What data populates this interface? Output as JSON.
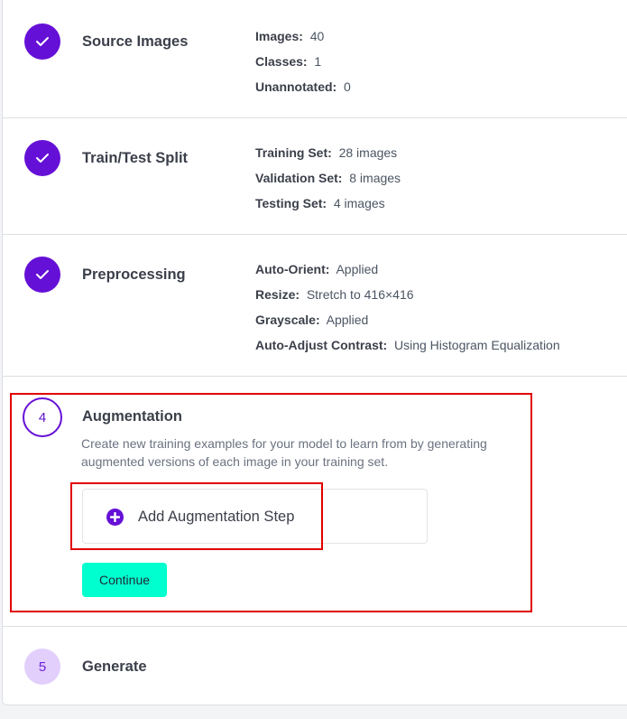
{
  "steps": [
    {
      "title": "Source Images",
      "details": [
        {
          "label": "Images:",
          "value": "40"
        },
        {
          "label": "Classes:",
          "value": "1"
        },
        {
          "label": "Unannotated:",
          "value": "0"
        }
      ]
    },
    {
      "title": "Train/Test Split",
      "details": [
        {
          "label": "Training Set:",
          "value": "28 images"
        },
        {
          "label": "Validation Set:",
          "value": "8 images"
        },
        {
          "label": "Testing Set:",
          "value": "4 images"
        }
      ]
    },
    {
      "title": "Preprocessing",
      "details": [
        {
          "label": "Auto-Orient:",
          "value": "Applied"
        },
        {
          "label": "Resize:",
          "value": "Stretch to 416×416"
        },
        {
          "label": "Grayscale:",
          "value": "Applied"
        },
        {
          "label": "Auto-Adjust Contrast:",
          "value": "Using Histogram Equalization"
        }
      ]
    }
  ],
  "augmentation": {
    "number": "4",
    "title": "Augmentation",
    "description": "Create new training examples for your model to learn from by generating augmented versions of each image in your training set.",
    "add_label": "Add Augmentation Step",
    "continue_label": "Continue"
  },
  "generate": {
    "number": "5",
    "title": "Generate"
  },
  "colors": {
    "accent": "#6510d6",
    "continue": "#00ffce",
    "highlight": "#e00000"
  }
}
